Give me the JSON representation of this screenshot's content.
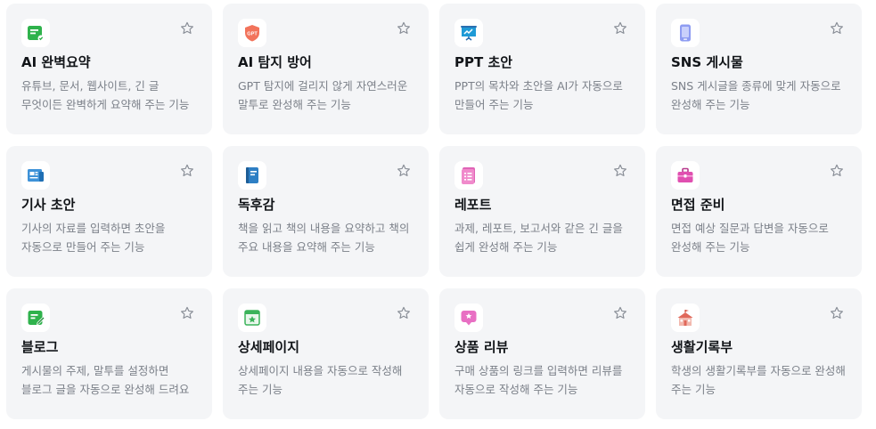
{
  "cards": [
    {
      "title": "AI 완벽요약",
      "desc": "유튜브, 문서, 웹사이트, 긴 글 무엇이든 완벽하게 요약해 주는 기능",
      "icon": "summary-icon",
      "color": "#2fb24c"
    },
    {
      "title": "AI 탐지 방어",
      "desc": "GPT 탐지에 걸리지 않게 자연스러운 말투로 완성해 주는 기능",
      "icon": "gpt-shield-icon",
      "color": "#f2735b",
      "icon_text": "GPT"
    },
    {
      "title": "PPT 초안",
      "desc": "PPT의 목차와 초안을 AI가 자동으로 만들어 주는 기능",
      "icon": "presentation-icon",
      "color": "#1f9ad6"
    },
    {
      "title": "SNS 게시물",
      "desc": "SNS 게시글을 종류에 맞게 자동으로 완성해 주는 기능",
      "icon": "phone-icon",
      "color": "#8e9cf2"
    },
    {
      "title": "기사 초안",
      "desc": "기사의 자료를 입력하면 초안을 자동으로 만들어 주는 기능",
      "icon": "newspaper-icon",
      "color": "#3e92d8"
    },
    {
      "title": "독후감",
      "desc": "책을 읽고 책의 내용을 요약하고 책의 주요 내용을 요약해 주는 기능",
      "icon": "book-icon",
      "color": "#2e7fc4"
    },
    {
      "title": "레포트",
      "desc": "과제, 레포트, 보고서와 같은 긴 글을 쉽게 완성해 주는 기능",
      "icon": "report-icon",
      "color": "#e063b6"
    },
    {
      "title": "면접 준비",
      "desc": "면접 예상 질문과 답변을 자동으로 완성해 주는 기능",
      "icon": "briefcase-icon",
      "color": "#e04fb0"
    },
    {
      "title": "블로그",
      "desc": "게시물의 주제, 말투를 설정하면 블로그 글을 자동으로 완성해 드려요",
      "icon": "blog-icon",
      "color": "#2fb24c"
    },
    {
      "title": "상세페이지",
      "desc": "상세페이지 내용을 자동으로 작성해 주는 기능",
      "icon": "product-page-icon",
      "color": "#3bb35a"
    },
    {
      "title": "상품 리뷰",
      "desc": "구매 상품의 링크를 입력하면 리뷰를 자동으로 작성해 주는 기능",
      "icon": "review-icon",
      "color": "#e86fc3"
    },
    {
      "title": "생활기록부",
      "desc": "학생의 생활기록부를 자동으로 완성해 주는 기능",
      "icon": "school-icon",
      "color": "#e0685a"
    }
  ]
}
